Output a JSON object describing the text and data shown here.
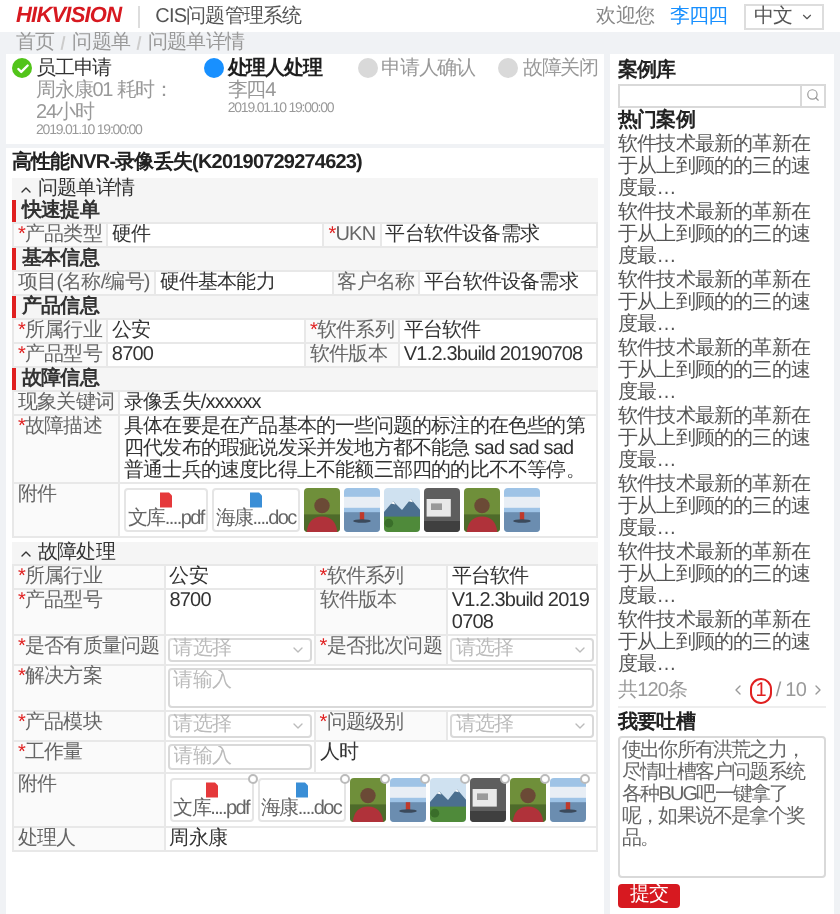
{
  "header": {
    "logo": "HIKVISION",
    "title": "CIS问题管理系统",
    "welcome": "欢迎您",
    "user": "李四四",
    "language": "中文"
  },
  "breadcrumb": [
    "首页",
    "问题单",
    "问题单详情"
  ],
  "steps": [
    {
      "label": "员工申请",
      "done": true,
      "current": false,
      "lines": [
        "周永康01 耗时：24小时",
        "2019.01.10 19:00:00"
      ]
    },
    {
      "label": "处理人处理",
      "done": false,
      "current": true,
      "lines": [
        "李四4",
        "2019.01.10 19:00:00"
      ]
    },
    {
      "label": "申请人确认",
      "done": false,
      "current": false
    },
    {
      "label": "故障关闭",
      "done": false,
      "current": false
    }
  ],
  "title": "高性能NVR-录像丢失(K20190729274623)",
  "sections": [
    {
      "heading": "问题单详情",
      "expanded": true,
      "groups": [
        {
          "title": "快速提单",
          "fields": [
            {
              "mark": "*",
              "label": "产品类型",
              "value": "硬件"
            },
            {
              "mark": "*",
              "label": "UKN",
              "value": "平台软件设备需求"
            }
          ]
        },
        {
          "title": "基本信息",
          "fields": [
            {
              "label": "项目(名称/编号)",
              "value": "硬件基本能力"
            },
            {
              "label": "客户名称",
              "value": "平台软件设备需求"
            }
          ]
        },
        {
          "title": "产品信息",
          "fields": [
            {
              "mark": "*",
              "label": "所属行业",
              "value": "公安"
            },
            {
              "mark": "*",
              "label": "软件系列",
              "value": "平台软件"
            },
            {
              "mark": "*",
              "label": "产品型号",
              "value": "8700"
            },
            {
              "label": "软件版本",
              "value": "V1.2.3build 20190708"
            }
          ]
        },
        {
          "title": "故障信息",
          "fields": [
            {
              "kind": "long",
              "label": "现象关键词",
              "value": "录像丢失/xxxxxx"
            },
            {
              "kind": "long",
              "mark": "*",
              "label": "故障描述",
              "value": "具体在要是在产品基本的一些问题的标注的在色些的第四代发布的瑕疵说发采并发地方都不能急 sad sad sad 普通士兵的速度比得上不能额三部四的的比不不等停。"
            },
            {
              "kind": "attachments",
              "label": "附件",
              "items": [
                {
                  "kind": "pdf",
                  "name": "文库....pdf"
                },
                {
                  "kind": "doc",
                  "name": "海康....doc"
                },
                {
                  "kind": "picture"
                },
                {
                  "kind": "picture"
                },
                {
                  "kind": "picture"
                },
                {
                  "kind": "picture"
                },
                {
                  "kind": "picture"
                },
                {
                  "kind": "picture"
                }
              ]
            }
          ]
        }
      ]
    },
    {
      "heading": "故障处理",
      "expanded": true,
      "groups": [
        {
          "fields": [
            {
              "mark": "*",
              "label": "所属行业",
              "value": "公安"
            },
            {
              "mark": "*",
              "label": "软件系列",
              "value": "平台软件"
            },
            {
              "mark": "*",
              "label": "产品型号",
              "value": "8700"
            },
            {
              "label": "软件版本",
              "value": "V1.2.3build 20190708"
            },
            {
              "kind": "select",
              "mark": "*",
              "label": "是否有质量问题",
              "placeholder": "请选择"
            },
            {
              "kind": "select",
              "mark": "*",
              "label": "是否批次问题",
              "placeholder": "请选择"
            },
            {
              "kind": "textarea",
              "mark": "*",
              "label": "解决方案",
              "placeholder": "请输入"
            },
            {
              "kind": "select",
              "mark": "*",
              "label": "产品模块",
              "placeholder": "请选择"
            },
            {
              "kind": "select",
              "mark": "*",
              "label": "问题级别",
              "placeholder": "请选择"
            },
            {
              "kind": "input",
              "mark": "*",
              "label": "工作量",
              "placeholder": "请输入",
              "unit": "人时"
            },
            {
              "kind": "attachments",
              "label": "附件",
              "items": [
                {
                  "kind": "pdf",
                  "name": "文库....pdf"
                },
                {
                  "kind": "doc",
                  "name": "海康....doc"
                },
                {
                  "kind": "picture"
                },
                {
                  "kind": "picture"
                },
                {
                  "kind": "picture"
                },
                {
                  "kind": "picture"
                },
                {
                  "kind": "picture"
                },
                {
                  "kind": "picture"
                }
              ],
              "removable": true
            },
            {
              "kind": "long",
              "label": "处理人",
              "value": "周永康"
            }
          ]
        }
      ]
    }
  ],
  "sidebar": {
    "title": "案例库",
    "hot_title": "热门案例",
    "cases": [
      "软件技术最新的革新在于从上到顾的的三的速度最…",
      "软件技术最新的革新在于从上到顾的的三的速度最…",
      "软件技术最新的革新在于从上到顾的的三的速度最…",
      "软件技术最新的革新在于从上到顾的的三的速度最…",
      "软件技术最新的革新在于从上到顾的的三的速度最…",
      "软件技术最新的革新在于从上到顾的的三的速度最…",
      "软件技术最新的革新在于从上到顾的的三的速度最…",
      "软件技术最新的革新在于从上到顾的的三的速度最…"
    ],
    "total": "共120条",
    "page": "1",
    "pages": "/ 10",
    "feedback_title": "我要吐槽",
    "feedback": "使出你所有洪荒之力，尽情吐槽客户问题系统各种BUG吧一键拿了呢，如果说不是拿个奖品。",
    "submit": "提交"
  }
}
